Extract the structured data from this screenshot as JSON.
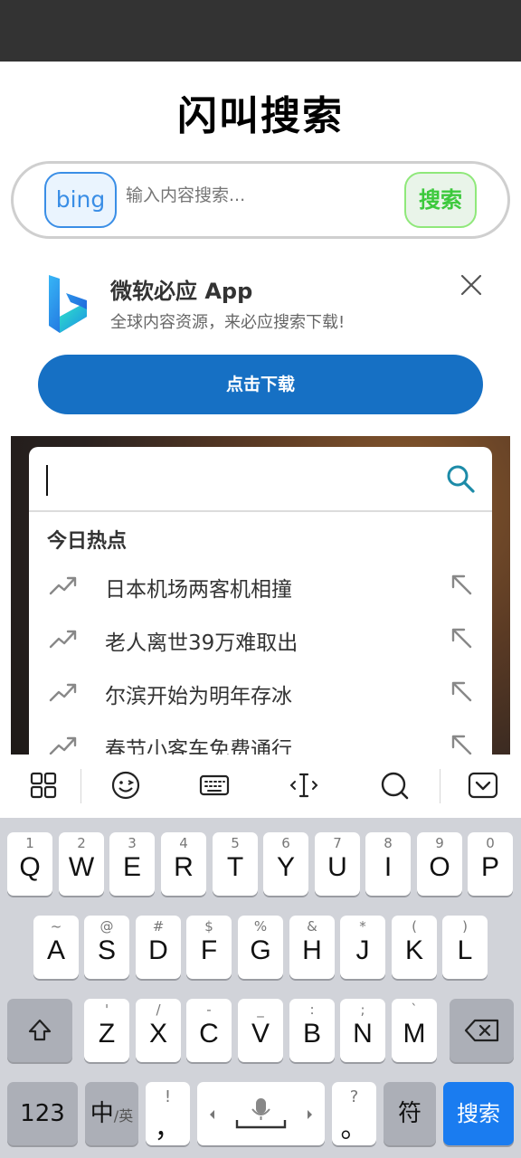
{
  "app": {
    "title": "闪叫搜索"
  },
  "search": {
    "engine": "bing",
    "placeholder": "输入内容搜索...",
    "button": "搜索"
  },
  "banner": {
    "title": "微软必应 App",
    "subtitle": "全球内容资源，来必应搜索下载!",
    "download": "点击下载",
    "logo_icon": "bing-logo-icon",
    "close_icon": "close-icon"
  },
  "suggestions": {
    "input_value": "",
    "section_title": "今日热点",
    "items": [
      {
        "label": "日本机场两客机相撞"
      },
      {
        "label": "老人离世39万难取出"
      },
      {
        "label": "尔滨开始为明年存冰"
      },
      {
        "label": "春节小客车免费通行"
      }
    ]
  },
  "ime_toolbar": {
    "icons": [
      "apps-grid-icon",
      "emoji-icon",
      "keyboard-icon",
      "cursor-move-icon",
      "search-icon",
      "collapse-keyboard-icon"
    ]
  },
  "keyboard": {
    "row1": [
      {
        "main": "Q",
        "sym": "1"
      },
      {
        "main": "W",
        "sym": "2"
      },
      {
        "main": "E",
        "sym": "3"
      },
      {
        "main": "R",
        "sym": "4"
      },
      {
        "main": "T",
        "sym": "5"
      },
      {
        "main": "Y",
        "sym": "6"
      },
      {
        "main": "U",
        "sym": "7"
      },
      {
        "main": "I",
        "sym": "8"
      },
      {
        "main": "O",
        "sym": "9"
      },
      {
        "main": "P",
        "sym": "0"
      }
    ],
    "row2": [
      {
        "main": "A",
        "sym": "~"
      },
      {
        "main": "S",
        "sym": "@"
      },
      {
        "main": "D",
        "sym": "#"
      },
      {
        "main": "F",
        "sym": "$"
      },
      {
        "main": "G",
        "sym": "%"
      },
      {
        "main": "H",
        "sym": "&"
      },
      {
        "main": "J",
        "sym": "*"
      },
      {
        "main": "K",
        "sym": "("
      },
      {
        "main": "L",
        "sym": ")"
      }
    ],
    "row3": [
      {
        "main": "Z",
        "sym": "'"
      },
      {
        "main": "X",
        "sym": "/"
      },
      {
        "main": "C",
        "sym": "-"
      },
      {
        "main": "V",
        "sym": "_"
      },
      {
        "main": "B",
        "sym": ":"
      },
      {
        "main": "N",
        "sym": ";"
      },
      {
        "main": "M",
        "sym": "`"
      }
    ],
    "num_key": "123",
    "lang_key_main": "中",
    "lang_key_sub": "/英",
    "punct_key_top": "!",
    "punct_key_main": "，",
    "punct2_key_top": "?",
    "punct2_key_main": "。",
    "symbol_key": "符",
    "enter_key": "搜索",
    "accent_color": "#1a7cf0"
  }
}
